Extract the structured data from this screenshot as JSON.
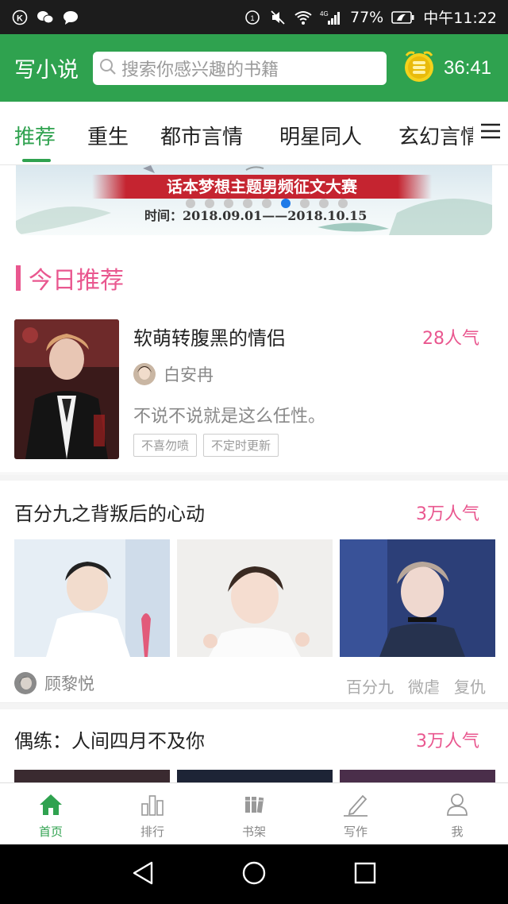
{
  "status_bar": {
    "battery": "77%",
    "network": "4G",
    "time": "中午11:22"
  },
  "app_bar": {
    "write_label": "写小说",
    "search_placeholder": "搜索你感兴趣的书籍",
    "coin_timer": "36:41"
  },
  "tabs": [
    {
      "label": "推荐",
      "active": true
    },
    {
      "label": "重生",
      "active": false
    },
    {
      "label": "都市言情",
      "active": false
    },
    {
      "label": "明星同人",
      "active": false
    },
    {
      "label": "玄幻言情",
      "active": false
    }
  ],
  "banner": {
    "title": "话本梦想主题男频征文大赛",
    "date": "时间：2018.09.01——2018.10.15",
    "dot_count": 9,
    "active_dot": 5
  },
  "section": {
    "title": "今日推荐"
  },
  "featured": {
    "title": "软萌转腹黑的情侣",
    "popularity": "28人气",
    "author": "白安冉",
    "description": "不说不说就是这么任性。",
    "tags": [
      "不喜勿喷",
      "不定时更新"
    ]
  },
  "story2": {
    "title": "百分九之背叛后的心动",
    "popularity": "3万人气",
    "author": "顾黎悦",
    "tags": [
      "百分九",
      "微虐",
      "复仇"
    ]
  },
  "story3": {
    "title": "偶练：人间四月不及你",
    "popularity": "3万人气"
  },
  "bottom_nav": [
    {
      "label": "首页",
      "icon": "home-icon",
      "active": true
    },
    {
      "label": "排行",
      "icon": "ranking-icon",
      "active": false
    },
    {
      "label": "书架",
      "icon": "bookshelf-icon",
      "active": false
    },
    {
      "label": "写作",
      "icon": "pencil-icon",
      "active": false
    },
    {
      "label": "我",
      "icon": "user-icon",
      "active": false
    }
  ],
  "colors": {
    "primary": "#2fa24f",
    "accent": "#e9578f",
    "banner_red": "#c52430"
  }
}
